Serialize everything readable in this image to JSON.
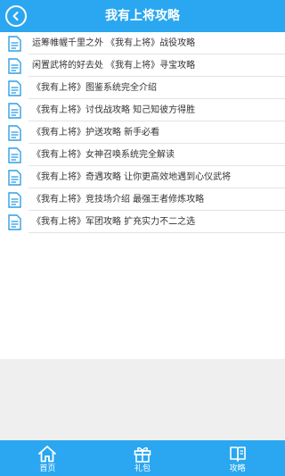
{
  "header": {
    "title": "我有上将攻略",
    "back_icon": "chevron-left-icon"
  },
  "list": {
    "icon": "document-icon",
    "items": [
      {
        "label": "运筹帷幄千里之外 《我有上将》战役攻略"
      },
      {
        "label": "闲置武将的好去处 《我有上将》寻宝攻略"
      },
      {
        "label": "《我有上将》图鉴系统完全介绍"
      },
      {
        "label": "《我有上将》讨伐战攻略 知己知彼方得胜"
      },
      {
        "label": "《我有上将》护送攻略 新手必看"
      },
      {
        "label": "《我有上将》女神召唤系统完全解读"
      },
      {
        "label": "《我有上将》奇遇攻略 让你更高效地遇到心仪武将"
      },
      {
        "label": "《我有上将》竞技场介绍 最强王者修炼攻略"
      },
      {
        "label": "《我有上将》军团攻略 扩充实力不二之选"
      }
    ]
  },
  "tabbar": {
    "tabs": [
      {
        "label": "首页",
        "icon": "home-icon"
      },
      {
        "label": "礼包",
        "icon": "gift-icon"
      },
      {
        "label": "攻略",
        "icon": "book-icon"
      }
    ]
  },
  "colors": {
    "primary": "#2aa7f0",
    "icon_blue": "#2f9fe6",
    "background": "#efefef",
    "list_background": "#ffffff",
    "text": "#333333",
    "divider": "#e3e3e3"
  }
}
